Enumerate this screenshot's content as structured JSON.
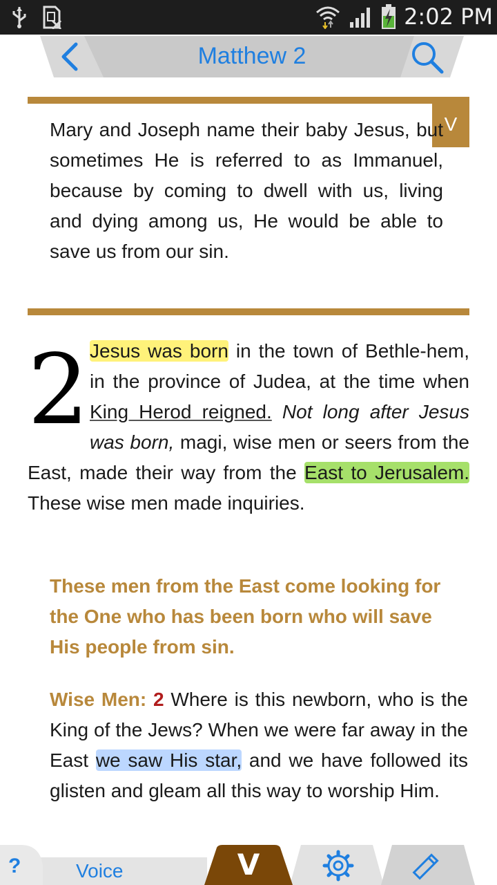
{
  "status_bar": {
    "time": "2:02 PM",
    "icons": [
      "usb-icon",
      "sd-card-icon",
      "wifi-icon",
      "signal-icon",
      "battery-charging-icon"
    ]
  },
  "header": {
    "title": "Matthew 2",
    "back_icon": "chevron-left-icon",
    "search_icon": "search-icon"
  },
  "devotional": {
    "badge": "V",
    "text": "Mary and Joseph name their baby Jesus, but sometimes He is referred to as Immanuel, because by coming to dwell with us, living and dying among us, He would be able to save us from our sin."
  },
  "passage": {
    "chapter_number": "2",
    "hl1": "Jesus was born",
    "t1": " in the town of Bethle-hem, in the province of Judea, at the time when ",
    "underlined": "King Herod reigned.",
    "t2": " ",
    "italic": "Not long after Jesus was born,",
    "t3": " magi, wise men or seers from the East, made their way from the ",
    "hl2": "East to Jerusalem.",
    "t4": " These wise men made inquiries.",
    "colors": {
      "yellow": "#fff27a",
      "green": "#a6e06a",
      "blue": "#bcd7ff"
    }
  },
  "summary": {
    "text": "These men from the East come looking for the One who has been born who will save His people from sin."
  },
  "dialogue": {
    "speaker": "Wise Men:",
    "verse": "2",
    "t1": " Where is this newborn, who is the King of the Jews? When we were far away in the East ",
    "hl": "we saw His star,",
    "t2": " and we have followed its glisten and gleam all this way to worship Him."
  },
  "bottom_bar": {
    "help": "?",
    "voice": "Voice",
    "v_label": "V",
    "gear_icon": "gear-icon",
    "pen_icon": "pencil-icon"
  },
  "colors": {
    "accent_gold": "#b8883b",
    "brown_tab": "#7a4708",
    "link_blue": "#1f7fe0",
    "verse_red": "#b11d1d"
  }
}
